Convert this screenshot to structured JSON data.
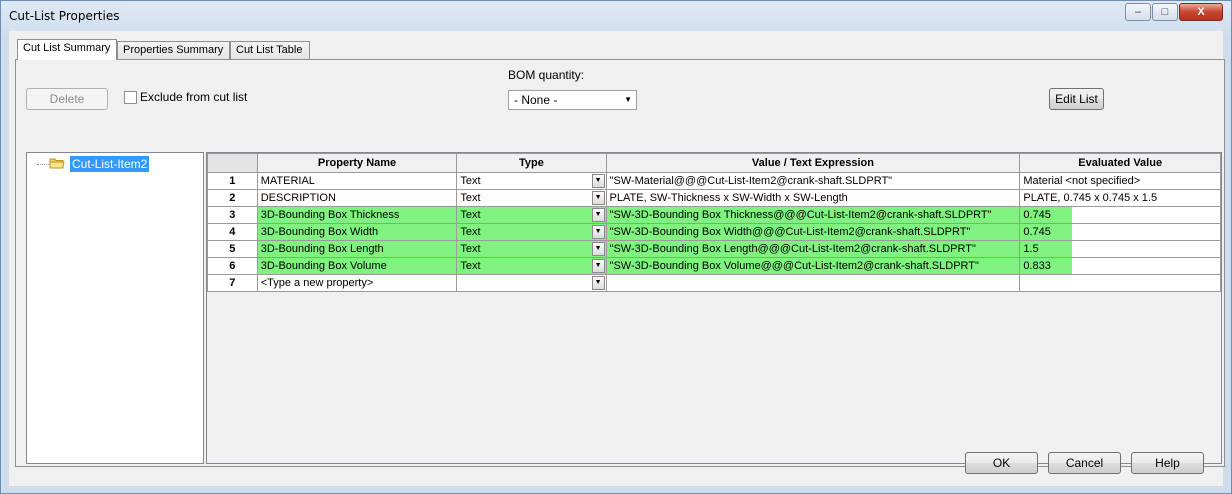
{
  "window": {
    "title": "Cut-List Properties",
    "minimize": "–",
    "maximize": "□",
    "close": "X"
  },
  "tabs": [
    {
      "label": "Cut List Summary",
      "active": true
    },
    {
      "label": "Properties Summary",
      "active": false
    },
    {
      "label": "Cut List Table",
      "active": false
    }
  ],
  "toolbar": {
    "delete_label": "Delete",
    "exclude_label": "Exclude from cut list",
    "bom_label": "BOM quantity:",
    "bom_value": "- None -",
    "edit_list_label": "Edit List"
  },
  "tree": {
    "item": "Cut-List-Item2",
    "icon": "folder-icon"
  },
  "table": {
    "headers": [
      "Property Name",
      "Type",
      "Value / Text Expression",
      "Evaluated Value"
    ],
    "rows": [
      {
        "num": "1",
        "name": "MATERIAL",
        "type": "Text",
        "value": "\"SW-Material@@@Cut-List-Item2@crank-shaft.SLDPRT\"",
        "evaluated": "Material <not specified>",
        "green": false
      },
      {
        "num": "2",
        "name": "DESCRIPTION",
        "type": "Text",
        "value": "PLATE, SW-Thickness x SW-Width x SW-Length",
        "evaluated": "PLATE, 0.745 x 0.745 x 1.5",
        "green": false
      },
      {
        "num": "3",
        "name": "3D-Bounding Box Thickness",
        "type": "Text",
        "value": "\"SW-3D-Bounding Box Thickness@@@Cut-List-Item2@crank-shaft.SLDPRT\"",
        "evaluated": "0.745",
        "green": true
      },
      {
        "num": "4",
        "name": "3D-Bounding Box Width",
        "type": "Text",
        "value": "\"SW-3D-Bounding Box Width@@@Cut-List-Item2@crank-shaft.SLDPRT\"",
        "evaluated": "0.745",
        "green": true
      },
      {
        "num": "5",
        "name": "3D-Bounding Box Length",
        "type": "Text",
        "value": "\"SW-3D-Bounding Box Length@@@Cut-List-Item2@crank-shaft.SLDPRT\"",
        "evaluated": "1.5",
        "green": true
      },
      {
        "num": "6",
        "name": "3D-Bounding Box Volume",
        "type": "Text",
        "value": "\"SW-3D-Bounding Box Volume@@@Cut-List-Item2@crank-shaft.SLDPRT\"",
        "evaluated": "0.833",
        "green": true
      },
      {
        "num": "7",
        "name": "<Type a new property>",
        "type": "",
        "value": "",
        "evaluated": "",
        "green": false
      }
    ]
  },
  "footer": {
    "ok": "OK",
    "cancel": "Cancel",
    "help": "Help"
  },
  "colors": {
    "highlight": "#7ff27f",
    "selection": "#3399ff"
  }
}
